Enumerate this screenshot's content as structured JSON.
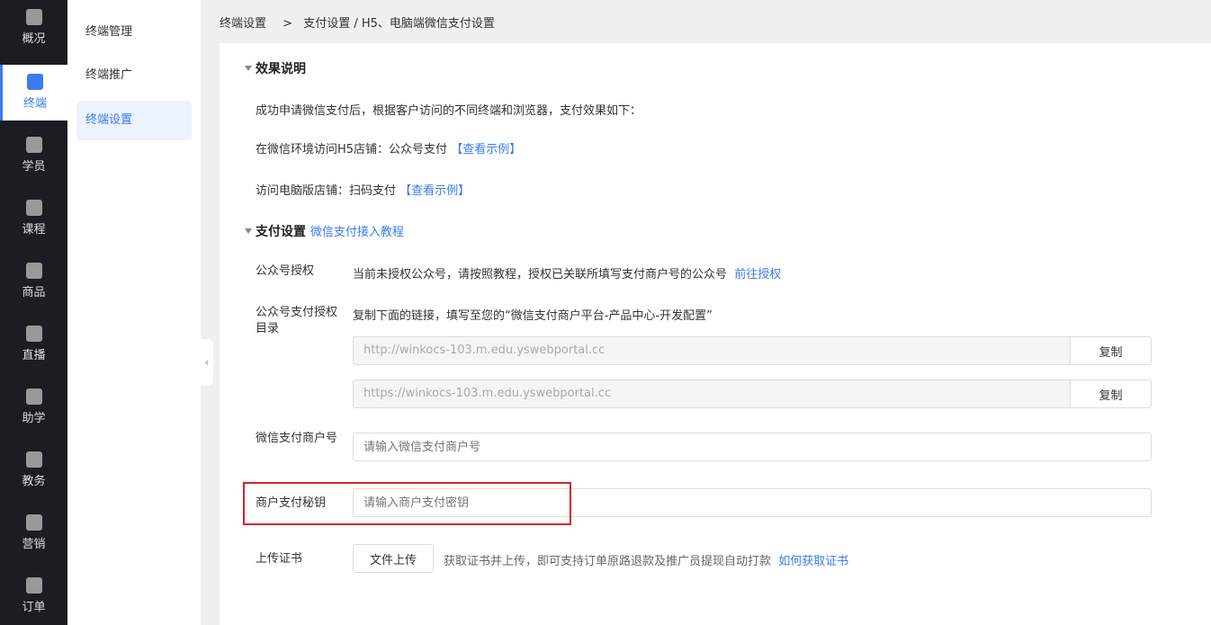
{
  "nav": [
    {
      "label": "概况",
      "icon": "chart-icon"
    },
    {
      "label": "终端",
      "icon": "store-icon",
      "active": true
    },
    {
      "label": "学员",
      "icon": "users-icon"
    },
    {
      "label": "课程",
      "icon": "book-icon"
    },
    {
      "label": "商品",
      "icon": "bag-icon"
    },
    {
      "label": "直播",
      "icon": "video-icon"
    },
    {
      "label": "助学",
      "icon": "gamepad-icon"
    },
    {
      "label": "教务",
      "icon": "box-icon"
    },
    {
      "label": "营销",
      "icon": "tag-icon"
    },
    {
      "label": "订单",
      "icon": "document-icon"
    }
  ],
  "subnav": [
    {
      "label": "终端管理"
    },
    {
      "label": "终端推广"
    },
    {
      "label": "终端设置",
      "active": true
    }
  ],
  "breadcrumb": {
    "first": "终端设置",
    "sep": ">",
    "rest": "支付设置 / H5、电脑端微信支付设置"
  },
  "effect": {
    "title": "效果说明",
    "intro": "成功申请微信支付后，根据客户访问的不同终端和浏览器，支付效果如下：",
    "line1": "在微信环境访问H5店铺：公众号支付",
    "line2": "访问电脑版店铺：扫码支付",
    "example_link": "【查看示例】"
  },
  "pay": {
    "title": "支付设置",
    "tutorial_link": "微信支付接入教程",
    "auth_label": "公众号授权",
    "auth_text": "当前未授权公众号，请按照教程，授权已关联所填写支付商户号的公众号",
    "auth_link": "前往授权",
    "dir_label": "公众号支付授权目录",
    "dir_text": "复制下面的链接，填写至您的“微信支付商户平台-产品中心-开发配置”",
    "url1": "http://winkocs-103.m.edu.yswebportal.cc",
    "url2": "https://winkocs-103.m.edu.yswebportal.cc",
    "copy_label": "复制",
    "merchant_label": "微信支付商户号",
    "merchant_placeholder": "请输入微信支付商户号",
    "secret_label": "商户支付秘钥",
    "secret_placeholder": "请输入商户支付密钥",
    "cert_label": "上传证书",
    "upload_label": "文件上传",
    "cert_text": "获取证书并上传，即可支持订单原路退款及推广员提现自动打款",
    "cert_link": "如何获取证书"
  }
}
